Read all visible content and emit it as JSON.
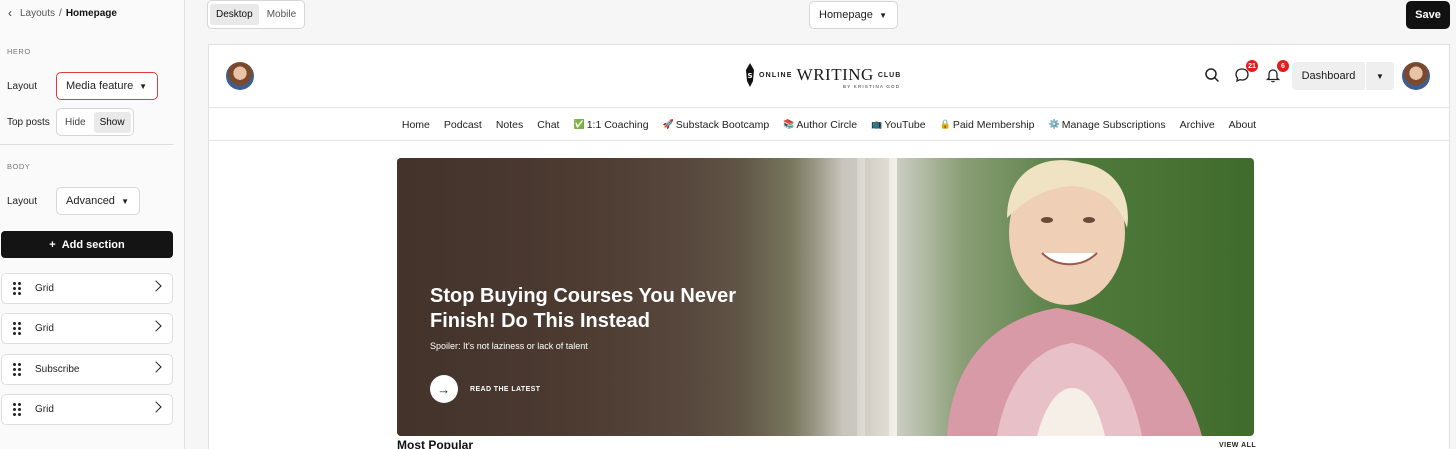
{
  "breadcrumb": {
    "parent": "Layouts",
    "separator": "/",
    "current": "Homepage"
  },
  "hero_section": {
    "heading": "HERO",
    "layout_label": "Layout",
    "layout_value": "Media feature",
    "top_posts_label": "Top posts",
    "top_posts_options": [
      "Hide",
      "Show"
    ],
    "top_posts_selected": "Show"
  },
  "body_section": {
    "heading": "BODY",
    "layout_label": "Layout",
    "layout_value": "Advanced",
    "add_section_label": "Add section",
    "sections": [
      {
        "label": "Grid"
      },
      {
        "label": "Grid"
      },
      {
        "label": "Subscribe"
      },
      {
        "label": "Grid"
      }
    ]
  },
  "toolbar": {
    "device_options": [
      "Desktop",
      "Mobile"
    ],
    "device_selected": "Desktop",
    "page_select": "Homepage",
    "save_label": "Save"
  },
  "site": {
    "logo": {
      "online": "ONLINE",
      "writing": "WRITING",
      "club": "CLUB",
      "byline": "BY KRISTINA GOD"
    },
    "chat_badge": "21",
    "notification_badge": "6",
    "dashboard_label": "Dashboard",
    "nav": [
      {
        "label": "Home",
        "emoji": ""
      },
      {
        "label": "Podcast",
        "emoji": ""
      },
      {
        "label": "Notes",
        "emoji": ""
      },
      {
        "label": "Chat",
        "emoji": ""
      },
      {
        "label": "1:1 Coaching",
        "emoji": "✅"
      },
      {
        "label": "Substack Bootcamp",
        "emoji": "🚀"
      },
      {
        "label": "Author Circle",
        "emoji": "📚"
      },
      {
        "label": "YouTube",
        "emoji": "📺"
      },
      {
        "label": "Paid Membership",
        "emoji": "🔒"
      },
      {
        "label": "Manage Subscriptions",
        "emoji": "⚙️"
      },
      {
        "label": "Archive",
        "emoji": ""
      },
      {
        "label": "About",
        "emoji": ""
      }
    ],
    "hero": {
      "title": "Stop Buying Courses You Never Finish! Do This Instead",
      "subtitle": "Spoiler: It's not laziness or lack of talent",
      "cta": "READ THE LATEST"
    },
    "most_popular": "Most Popular",
    "view_all": "VIEW ALL"
  },
  "colors": {
    "accent_red": "#e03a3a",
    "dark": "#141414",
    "badge": "#e01e1e"
  }
}
